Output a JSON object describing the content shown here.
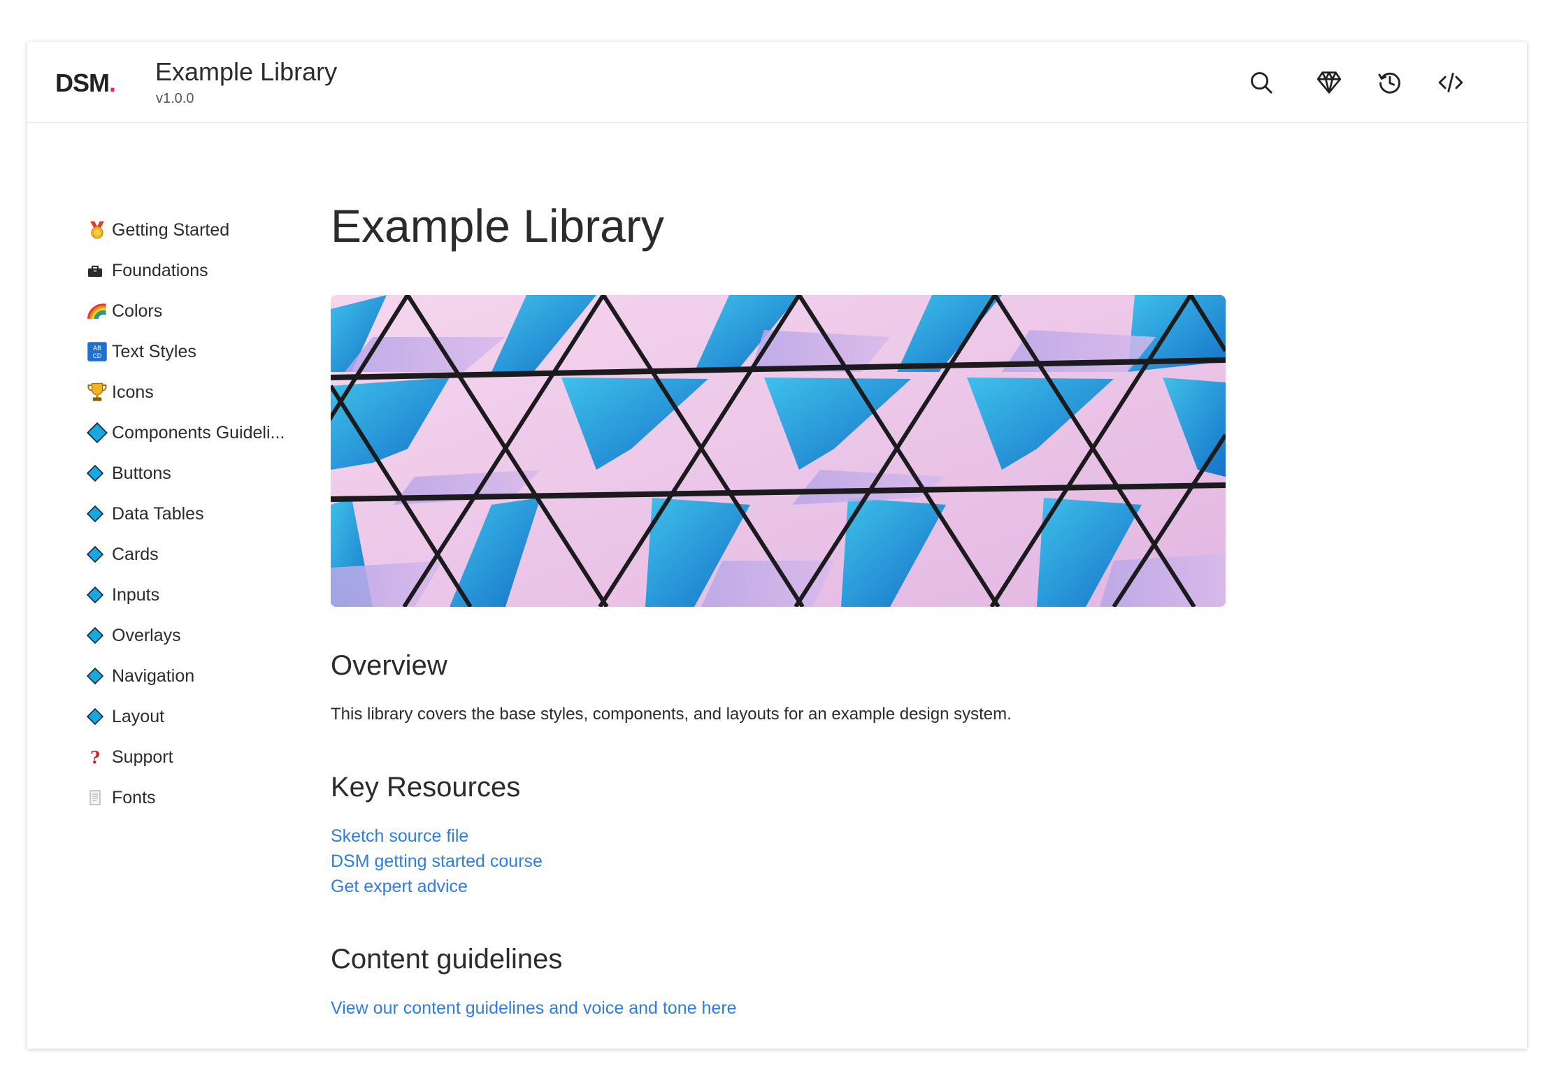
{
  "header": {
    "logo_text": "DSM",
    "logo_dot": ".",
    "library_title": "Example Library",
    "version": "v1.0.0",
    "icons": [
      "search-icon",
      "sketch-diamond-icon",
      "history-icon",
      "code-icon"
    ]
  },
  "sidebar": {
    "items": [
      {
        "label": "Getting Started",
        "icon": "medal-icon"
      },
      {
        "label": "Foundations",
        "icon": "toolbox-icon"
      },
      {
        "label": "Colors",
        "icon": "rainbow-icon"
      },
      {
        "label": "Text Styles",
        "icon": "abcd-icon"
      },
      {
        "label": "Icons",
        "icon": "trophy-icon"
      },
      {
        "label": "Components Guideli...",
        "icon": "diamond-icon"
      },
      {
        "label": "Buttons",
        "icon": "diamond-icon"
      },
      {
        "label": "Data Tables",
        "icon": "diamond-icon"
      },
      {
        "label": "Cards",
        "icon": "diamond-icon"
      },
      {
        "label": "Inputs",
        "icon": "diamond-icon"
      },
      {
        "label": "Overlays",
        "icon": "diamond-icon"
      },
      {
        "label": "Navigation",
        "icon": "diamond-icon"
      },
      {
        "label": "Layout",
        "icon": "diamond-icon"
      },
      {
        "label": "Support",
        "icon": "question-icon"
      },
      {
        "label": "Fonts",
        "icon": "page-icon"
      }
    ]
  },
  "main": {
    "title": "Example Library",
    "overview_heading": "Overview",
    "overview_text": "This library covers the base styles, components, and layouts for an example design system.",
    "resources_heading": "Key Resources",
    "resources_links": [
      "Sketch source file",
      "DSM getting started course",
      "Get expert advice"
    ],
    "guidelines_heading": "Content guidelines",
    "guidelines_link": "View our content guidelines and voice and tone here"
  },
  "colors": {
    "accent": "#e8275a",
    "link": "#2f7de1",
    "text": "#2b2b2e",
    "hero_pink": "#f0c8e6",
    "hero_blue": "#1b8fd3"
  }
}
